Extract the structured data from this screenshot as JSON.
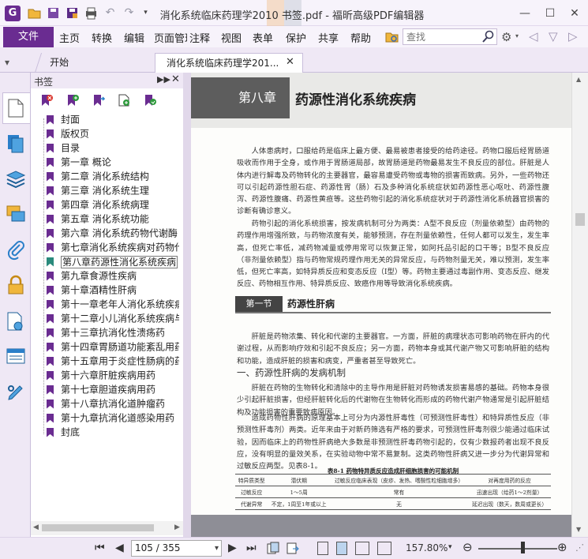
{
  "window": {
    "title": "消化系统临床药理学2010 书签.pdf - 福昕高级PDF编辑器",
    "app_icon_glyph": "G",
    "controls": [
      "—",
      "☐",
      "✕"
    ]
  },
  "quick_access": [
    "folder-icon",
    "save-icon",
    "save-as-icon",
    "print-icon",
    "undo-icon",
    "redo-icon",
    "customize-icon"
  ],
  "menu": {
    "file": "文件",
    "items": [
      "主页",
      "转换",
      "编辑",
      "页面管理",
      "注释",
      "视图",
      "表单",
      "保护",
      "共享",
      "帮助"
    ],
    "search_placeholder": "查找"
  },
  "tabs": [
    {
      "label": "开始",
      "active": false
    },
    {
      "label": "消化系统临床药理学201...",
      "active": true
    }
  ],
  "sidebar": {
    "panel_title": "书签",
    "icons": [
      "pages-icon",
      "layers-icon",
      "comments-icon",
      "attachments-icon",
      "security-icon",
      "properties-icon",
      "content-icon",
      "edit-icon"
    ]
  },
  "bookmarks": [
    {
      "label": "封面"
    },
    {
      "label": "版权页"
    },
    {
      "label": "目录"
    },
    {
      "label": "第一章 概论"
    },
    {
      "label": "第二章 消化系统结构"
    },
    {
      "label": "第三章 消化系统生理"
    },
    {
      "label": "第四章 消化系统病理"
    },
    {
      "label": "第五章 消化系统功能"
    },
    {
      "label": "第六章 消化系统药物代谢酶"
    },
    {
      "label": "第七章消化系统疾病对药物代"
    },
    {
      "label": "第八章药源性消化系统疾病",
      "selected": true
    },
    {
      "label": "第九章食源性疾病"
    },
    {
      "label": "第十章酒精性肝病"
    },
    {
      "label": "第十一章老年人消化系统疾病"
    },
    {
      "label": "第十二章小儿消化系统疾病与"
    },
    {
      "label": "第十三章抗消化性溃疡药"
    },
    {
      "label": "第十四章胃肠道功能紊乱用药"
    },
    {
      "label": "第十五章用于炎症性肠病的药"
    },
    {
      "label": "第十六章肝脏疾病用药"
    },
    {
      "label": "第十七章胆道疾病用药"
    },
    {
      "label": "第十八章抗消化道肿瘤药"
    },
    {
      "label": "第十九章抗消化道感染用药"
    },
    {
      "label": "封底"
    }
  ],
  "document": {
    "chapter_label": "第八章",
    "chapter_title": "药源性消化系统疾病",
    "para1": "人体患病时，口服给药是临床上最方便、最易被患者接受的给药途径。药物口服后经胃肠道吸收而作用于全身，或作用于胃肠道局部，故胃肠道是药物最易发生不良反应的部位。肝脏是人体内进行解毒及药物转化的主要器官，最容易遭受药物或毒物的损害而致病。另外，一些药物还可以引起药源性胆石症、药源性胃（肠）石及多种消化系统症状如药源性恶心呕吐、药源性腹泻、药源性腹痛、药源性黄疸等。这些药物引起的消化系统症状对于药源性消化系统器官损害的诊断有确诊意义。",
    "para2": "药物引起的消化系统损害，按发病机制可分为两类：A型不良反应（剂量依赖型）由药物的药理作用增强所致，与药物浓度有关，能够预测，存在剂量依赖性，任何人都可以发生，发生率高，但死亡率低，减药物减量或停用常可以恢复正常，如阿托品引起的口干等；B型不良反应（非剂量依赖型）指与药物常规药理作用无关的异常反应，与药物剂量无关，难以预测，发生率低，但死亡率高，如特异质反应和变态反应（Ⅰ型）等。药物主要通过毒副作用、变态反应、继发反应、药物相互作用、特异质反应、致癌作用等导致消化系统疾病。",
    "section_label": "第一节",
    "section_title": "药源性肝病",
    "para3": "肝脏是药物浓集、转化和代谢的主要器官。一方面，肝脏的病理状态可影响药物在肝内的代谢过程，从而影响疗效和引起不良反应；另一方面，药物本身或其代谢产物又可影响肝脏的结构和功能，造成肝脏的损害和病变，严重者甚至导致死亡。",
    "subsection_title": "一、药源性肝病的发病机制",
    "para4": "肝脏在药物的生物转化和清除中的主导作用是肝脏对药物诱发损害易感的基础。药物本身很少引起肝脏损害，但经肝脏转化后的代谢物在生物转化而形成的药物代谢产物通常是引起肝脏结构及功能损害的重要致病原因。",
    "para5": "造成药物性肝病的原理基本上可分为内源性肝毒性（可预测性肝毒性）和特异质性反应（非预测性肝毒剂）两类。近年来由于对新药筛选有严格的要求，可预测性肝毒剂很少能通过临床试验，因而临床上的药物性肝病绝大多数是非预测性肝毒药物引起的，仅有少数报药者出现不良反应，没有明显的量效关系，在实验动物中常不易复制。这类药物性肝病又进一步分为代谢异常和过敏反应两型。见表8-1。",
    "table_title": "表8-1  药物特异质反应造成肝细胞损害的可能机制",
    "table_headers": [
      "特异质类型",
      "潜伏期",
      "过敏反应临床表现（皮疹、发热、嗜酸性粒细胞增多）",
      "对再度用药的反应"
    ],
    "table_rows": [
      [
        "过敏反应",
        "1～5周",
        "常有",
        "迅速出现（给药1～2剂量）"
      ],
      [
        "代谢异常",
        "不定，1周至1年或以上",
        "无",
        "延迟出现（数天，数周或更长）"
      ]
    ]
  },
  "status": {
    "page_display": "105 / 355",
    "zoom": "157.80%",
    "zoom_fraction": 0.56
  }
}
